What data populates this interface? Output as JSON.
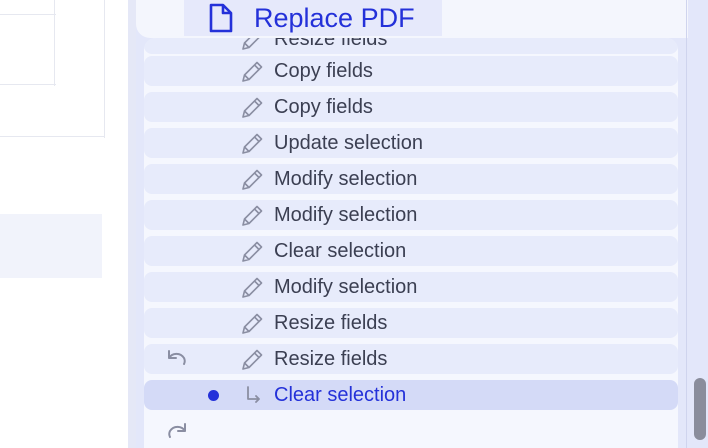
{
  "toolbar": {
    "replace_label": "Replace PDF"
  },
  "history": {
    "items": [
      {
        "label": "Resize fields"
      },
      {
        "label": "Copy fields"
      },
      {
        "label": "Copy fields"
      },
      {
        "label": "Update selection"
      },
      {
        "label": "Modify selection"
      },
      {
        "label": "Modify selection"
      },
      {
        "label": "Clear selection"
      },
      {
        "label": "Modify selection"
      },
      {
        "label": "Resize fields"
      },
      {
        "label": "Resize fields"
      },
      {
        "label": "Clear selection"
      }
    ],
    "current_index": 10,
    "undo_marker_index": 9
  },
  "colors": {
    "accent": "#2431d9",
    "item_bg": "#e7ebfb",
    "current_bg": "#d4daf7",
    "panel_bg": "#f5f7fe",
    "text": "#3b3f52"
  }
}
